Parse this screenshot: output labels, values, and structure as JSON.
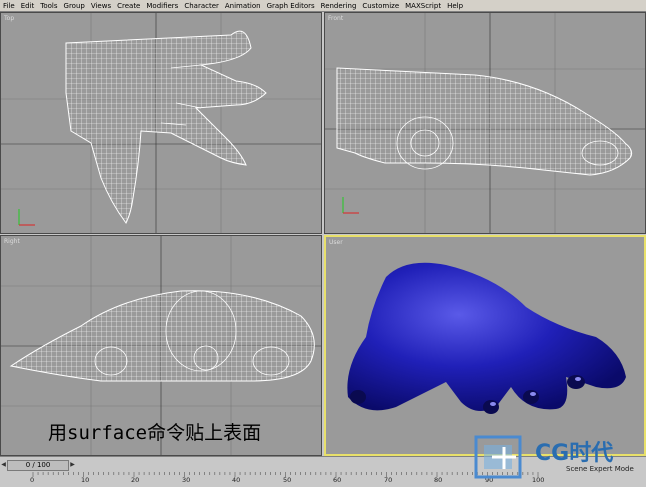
{
  "menu": [
    "File",
    "Edit",
    "Tools",
    "Group",
    "Views",
    "Create",
    "Modifiers",
    "Character",
    "Animation",
    "Graph Editors",
    "Rendering",
    "Customize",
    "MAXScript",
    "Help"
  ],
  "viewports": {
    "top": "Top",
    "front": "Front",
    "right": "Right",
    "user": "User"
  },
  "caption": "用surface命令贴上表面",
  "timeline": {
    "frame": "0 / 100",
    "ticks": [
      "0",
      "10",
      "20",
      "30",
      "40",
      "50",
      "60",
      "70",
      "80",
      "90",
      "100"
    ]
  },
  "logo": {
    "text": "CG时代",
    "sub": "Scene Expert Mode"
  },
  "colors": {
    "viewport_bg": "#9a9a9a",
    "wireframe": "#ffffff",
    "shaded": "#1a1ab0",
    "active_border": "#e8e06a"
  }
}
